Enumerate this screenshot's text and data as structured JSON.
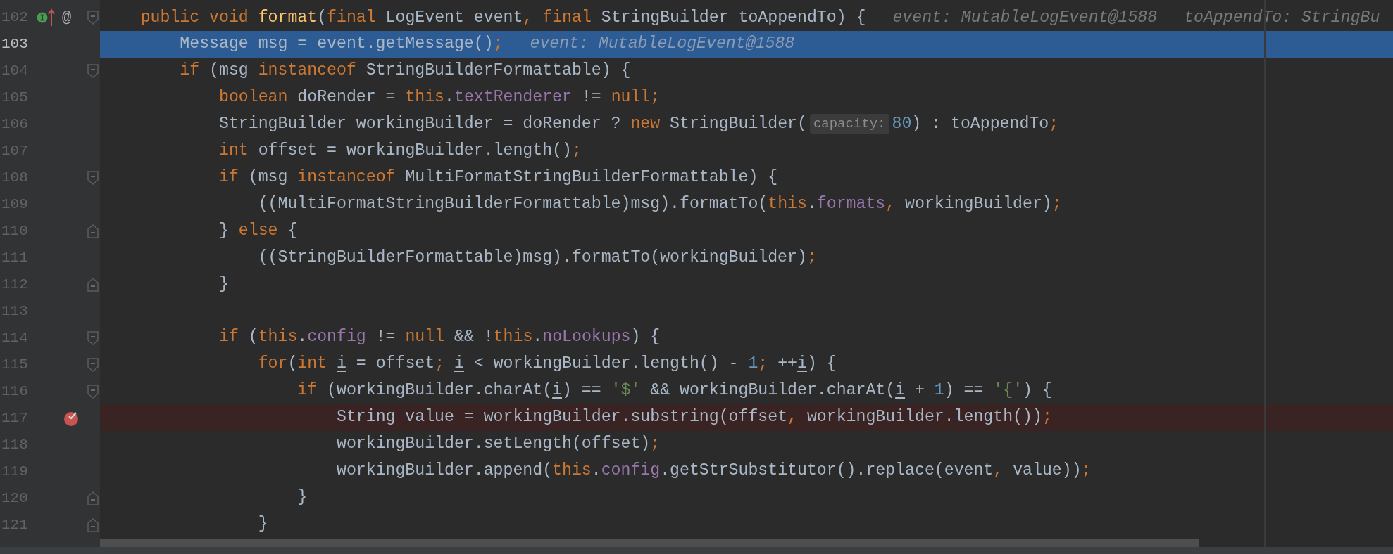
{
  "editor": {
    "lines": [
      {
        "number": "102",
        "current": false,
        "breakpoint": false,
        "fold_start": true,
        "fold_end": false,
        "implements": true,
        "overrides": true,
        "annotation": "@",
        "tokens": [
          {
            "kind": "keyword",
            "text": "    public void "
          },
          {
            "kind": "declaration",
            "text": "format"
          },
          {
            "kind": "plain",
            "text": "("
          },
          {
            "kind": "keyword",
            "text": "final "
          },
          {
            "kind": "plain",
            "text": "LogEvent event"
          },
          {
            "kind": "keyword",
            "text": ", final "
          },
          {
            "kind": "plain",
            "text": "StringBuilder toAppendTo) {"
          },
          {
            "kind": "hint",
            "text": "event: MutableLogEvent@1588"
          },
          {
            "kind": "hint",
            "text": "toAppendTo: StringBu"
          }
        ]
      },
      {
        "number": "103",
        "current": true,
        "breakpoint": false,
        "fold_start": false,
        "fold_end": false,
        "implements": false,
        "overrides": false,
        "tokens": [
          {
            "kind": "plain",
            "text": "        Message msg = event.getMessage()"
          },
          {
            "kind": "keyword",
            "text": ";"
          },
          {
            "kind": "hint",
            "text": "event: MutableLogEvent@1588"
          }
        ]
      },
      {
        "number": "104",
        "current": false,
        "breakpoint": false,
        "fold_start": true,
        "fold_end": false,
        "implements": false,
        "overrides": false,
        "tokens": [
          {
            "kind": "keyword",
            "text": "        if "
          },
          {
            "kind": "plain",
            "text": "(msg "
          },
          {
            "kind": "keyword",
            "text": "instanceof "
          },
          {
            "kind": "plain",
            "text": "StringBuilderFormattable) {"
          }
        ]
      },
      {
        "number": "105",
        "current": false,
        "breakpoint": false,
        "fold_start": false,
        "fold_end": false,
        "implements": false,
        "overrides": false,
        "tokens": [
          {
            "kind": "keyword",
            "text": "            boolean "
          },
          {
            "kind": "plain",
            "text": "doRender = "
          },
          {
            "kind": "keyword",
            "text": "this"
          },
          {
            "kind": "plain",
            "text": "."
          },
          {
            "kind": "field",
            "text": "textRenderer"
          },
          {
            "kind": "plain",
            "text": " != "
          },
          {
            "kind": "keyword",
            "text": "null;"
          }
        ]
      },
      {
        "number": "106",
        "current": false,
        "breakpoint": false,
        "fold_start": false,
        "fold_end": false,
        "implements": false,
        "overrides": false,
        "tokens": [
          {
            "kind": "plain",
            "text": "            StringBuilder workingBuilder = doRender ? "
          },
          {
            "kind": "keyword",
            "text": "new "
          },
          {
            "kind": "plain",
            "text": "StringBuilder("
          },
          {
            "kind": "inlay",
            "text": "capacity:"
          },
          {
            "kind": "number",
            "text": "80"
          },
          {
            "kind": "plain",
            "text": ") : toAppendTo"
          },
          {
            "kind": "keyword",
            "text": ";"
          }
        ]
      },
      {
        "number": "107",
        "current": false,
        "breakpoint": false,
        "fold_start": false,
        "fold_end": false,
        "implements": false,
        "overrides": false,
        "tokens": [
          {
            "kind": "keyword",
            "text": "            int "
          },
          {
            "kind": "plain",
            "text": "offset = workingBuilder.length()"
          },
          {
            "kind": "keyword",
            "text": ";"
          }
        ]
      },
      {
        "number": "108",
        "current": false,
        "breakpoint": false,
        "fold_start": true,
        "fold_end": false,
        "implements": false,
        "overrides": false,
        "tokens": [
          {
            "kind": "keyword",
            "text": "            if "
          },
          {
            "kind": "plain",
            "text": "(msg "
          },
          {
            "kind": "keyword",
            "text": "instanceof "
          },
          {
            "kind": "plain",
            "text": "MultiFormatStringBuilderFormattable) {"
          }
        ]
      },
      {
        "number": "109",
        "current": false,
        "breakpoint": false,
        "fold_start": false,
        "fold_end": false,
        "implements": false,
        "overrides": false,
        "tokens": [
          {
            "kind": "plain",
            "text": "                ((MultiFormatStringBuilderFormattable)msg).formatTo("
          },
          {
            "kind": "keyword",
            "text": "this"
          },
          {
            "kind": "plain",
            "text": "."
          },
          {
            "kind": "field",
            "text": "formats"
          },
          {
            "kind": "keyword",
            "text": ", "
          },
          {
            "kind": "plain",
            "text": "workingBuilder)"
          },
          {
            "kind": "keyword",
            "text": ";"
          }
        ]
      },
      {
        "number": "110",
        "current": false,
        "breakpoint": false,
        "fold_start": false,
        "fold_end": true,
        "implements": false,
        "overrides": false,
        "tokens": [
          {
            "kind": "plain",
            "text": "            } "
          },
          {
            "kind": "keyword",
            "text": "else "
          },
          {
            "kind": "plain",
            "text": "{"
          }
        ]
      },
      {
        "number": "111",
        "current": false,
        "breakpoint": false,
        "fold_start": false,
        "fold_end": false,
        "implements": false,
        "overrides": false,
        "tokens": [
          {
            "kind": "plain",
            "text": "                ((StringBuilderFormattable)msg).formatTo(workingBuilder)"
          },
          {
            "kind": "keyword",
            "text": ";"
          }
        ]
      },
      {
        "number": "112",
        "current": false,
        "breakpoint": false,
        "fold_start": false,
        "fold_end": true,
        "implements": false,
        "overrides": false,
        "tokens": [
          {
            "kind": "plain",
            "text": "            }"
          }
        ]
      },
      {
        "number": "113",
        "current": false,
        "breakpoint": false,
        "fold_start": false,
        "fold_end": false,
        "implements": false,
        "overrides": false
      },
      {
        "number": "114",
        "current": false,
        "breakpoint": false,
        "fold_start": true,
        "fold_end": false,
        "implements": false,
        "overrides": false,
        "tokens": [
          {
            "kind": "keyword",
            "text": "            if "
          },
          {
            "kind": "plain",
            "text": "("
          },
          {
            "kind": "keyword",
            "text": "this"
          },
          {
            "kind": "plain",
            "text": "."
          },
          {
            "kind": "field",
            "text": "config"
          },
          {
            "kind": "plain",
            "text": " != "
          },
          {
            "kind": "keyword",
            "text": "null "
          },
          {
            "kind": "plain",
            "text": "&& !"
          },
          {
            "kind": "keyword",
            "text": "this"
          },
          {
            "kind": "plain",
            "text": "."
          },
          {
            "kind": "field",
            "text": "noLookups"
          },
          {
            "kind": "plain",
            "text": ") {"
          }
        ]
      },
      {
        "number": "115",
        "current": false,
        "breakpoint": false,
        "fold_start": true,
        "fold_end": false,
        "implements": false,
        "overrides": false,
        "tokens": [
          {
            "kind": "keyword",
            "text": "                for"
          },
          {
            "kind": "plain",
            "text": "("
          },
          {
            "kind": "keyword",
            "text": "int "
          },
          {
            "kind": "reassigned",
            "text": "i"
          },
          {
            "kind": "plain",
            "text": " = offset"
          },
          {
            "kind": "keyword",
            "text": "; "
          },
          {
            "kind": "reassigned",
            "text": "i"
          },
          {
            "kind": "plain",
            "text": " < workingBuilder.length() - "
          },
          {
            "kind": "number",
            "text": "1"
          },
          {
            "kind": "keyword",
            "text": "; "
          },
          {
            "kind": "plain",
            "text": "++"
          },
          {
            "kind": "reassigned",
            "text": "i"
          },
          {
            "kind": "plain",
            "text": ") {"
          }
        ]
      },
      {
        "number": "116",
        "current": false,
        "breakpoint": false,
        "fold_start": true,
        "fold_end": false,
        "implements": false,
        "overrides": false,
        "tokens": [
          {
            "kind": "keyword",
            "text": "                    if "
          },
          {
            "kind": "plain",
            "text": "(workingBuilder.charAt("
          },
          {
            "kind": "reassigned",
            "text": "i"
          },
          {
            "kind": "plain",
            "text": ") == "
          },
          {
            "kind": "string",
            "text": "'$'"
          },
          {
            "kind": "plain",
            "text": " && workingBuilder.charAt("
          },
          {
            "kind": "reassigned",
            "text": "i"
          },
          {
            "kind": "plain",
            "text": " + "
          },
          {
            "kind": "number",
            "text": "1"
          },
          {
            "kind": "plain",
            "text": ") == "
          },
          {
            "kind": "string",
            "text": "'{'"
          },
          {
            "kind": "plain",
            "text": ") {"
          }
        ]
      },
      {
        "number": "117",
        "current": false,
        "breakpoint": true,
        "fold_start": false,
        "fold_end": false,
        "implements": false,
        "overrides": false,
        "tokens": [
          {
            "kind": "plain",
            "text": "                        String value = workingBuilder.substring(offset"
          },
          {
            "kind": "keyword",
            "text": ", "
          },
          {
            "kind": "plain",
            "text": "workingBuilder.length())"
          },
          {
            "kind": "keyword",
            "text": ";"
          }
        ]
      },
      {
        "number": "118",
        "current": false,
        "breakpoint": false,
        "fold_start": false,
        "fold_end": false,
        "implements": false,
        "overrides": false,
        "tokens": [
          {
            "kind": "plain",
            "text": "                        workingBuilder.setLength(offset)"
          },
          {
            "kind": "keyword",
            "text": ";"
          }
        ]
      },
      {
        "number": "119",
        "current": false,
        "breakpoint": false,
        "fold_start": false,
        "fold_end": false,
        "implements": false,
        "overrides": false,
        "tokens": [
          {
            "kind": "plain",
            "text": "                        workingBuilder.append("
          },
          {
            "kind": "keyword",
            "text": "this"
          },
          {
            "kind": "plain",
            "text": "."
          },
          {
            "kind": "field",
            "text": "config"
          },
          {
            "kind": "plain",
            "text": ".getStrSubstitutor().replace(event"
          },
          {
            "kind": "keyword",
            "text": ", "
          },
          {
            "kind": "plain",
            "text": "value))"
          },
          {
            "kind": "keyword",
            "text": ";"
          }
        ]
      },
      {
        "number": "120",
        "current": false,
        "breakpoint": false,
        "fold_start": false,
        "fold_end": true,
        "implements": false,
        "overrides": false,
        "tokens": [
          {
            "kind": "plain",
            "text": "                    }"
          }
        ]
      },
      {
        "number": "121",
        "current": false,
        "breakpoint": false,
        "fold_start": false,
        "fold_end": true,
        "implements": false,
        "overrides": false,
        "tokens": [
          {
            "kind": "plain",
            "text": "                }"
          }
        ]
      }
    ]
  }
}
